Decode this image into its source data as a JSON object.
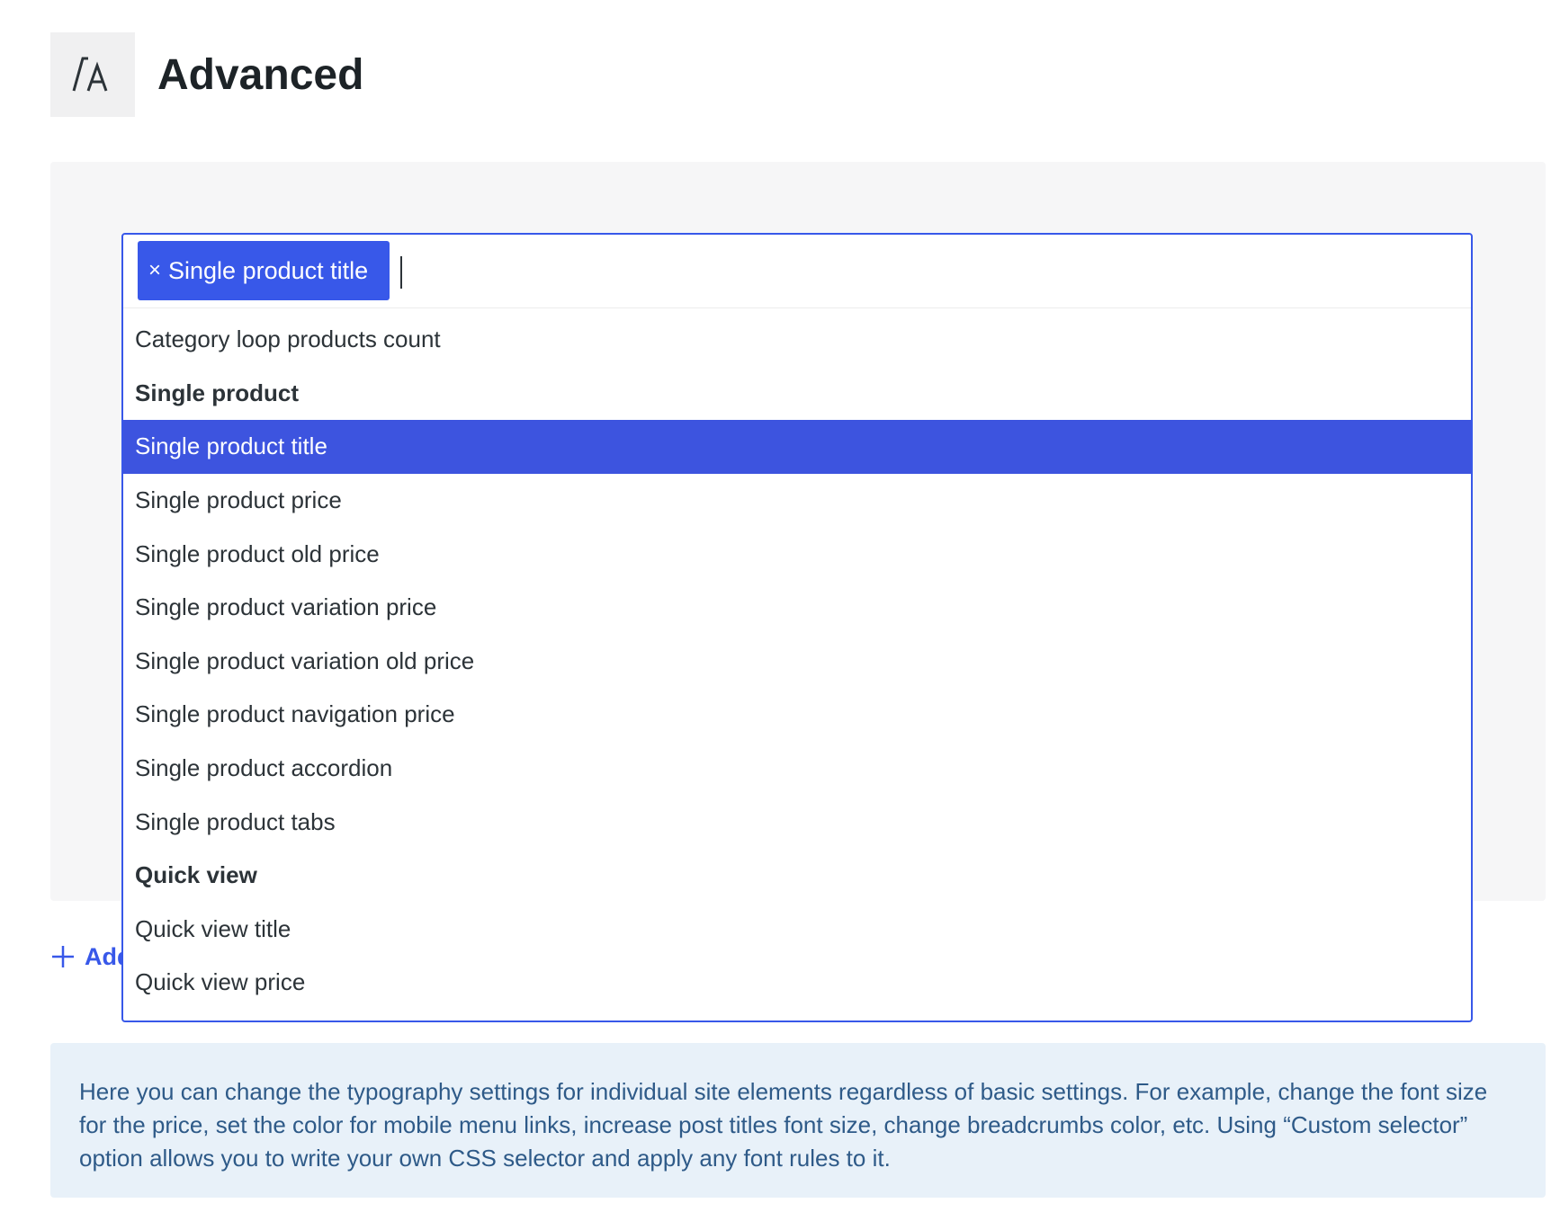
{
  "header": {
    "icon": "typography-icon",
    "title": "Advanced"
  },
  "select": {
    "chip_label": "Single product title",
    "chip_remove": "×",
    "options": [
      {
        "label": "Category loop products count",
        "type": "option"
      },
      {
        "label": "Single product",
        "type": "group"
      },
      {
        "label": "Single product title",
        "type": "option",
        "selected": true
      },
      {
        "label": "Single product price",
        "type": "option"
      },
      {
        "label": "Single product old price",
        "type": "option"
      },
      {
        "label": "Single product variation price",
        "type": "option"
      },
      {
        "label": "Single product variation old price",
        "type": "option"
      },
      {
        "label": "Single product navigation price",
        "type": "option"
      },
      {
        "label": "Single product accordion",
        "type": "option"
      },
      {
        "label": "Single product tabs",
        "type": "option"
      },
      {
        "label": "Quick view",
        "type": "group"
      },
      {
        "label": "Quick view title",
        "type": "option"
      },
      {
        "label": "Quick view price",
        "type": "option"
      }
    ]
  },
  "add_button": {
    "icon": "plus-icon",
    "label": "Add"
  },
  "info": {
    "text": "Here you can change the typography settings for individual site elements regardless of basic settings. For example, change the font size for the price, set the color for mobile menu links, increase post titles font size, change breadcrumbs color, etc. Using “Custom selector” option allows you to write your own CSS selector and apply any font rules to it."
  },
  "colors": {
    "accent": "#3858e9",
    "selected_option": "#3d54df",
    "info_bg": "#e8f1f9",
    "info_text": "#2e5a88"
  }
}
